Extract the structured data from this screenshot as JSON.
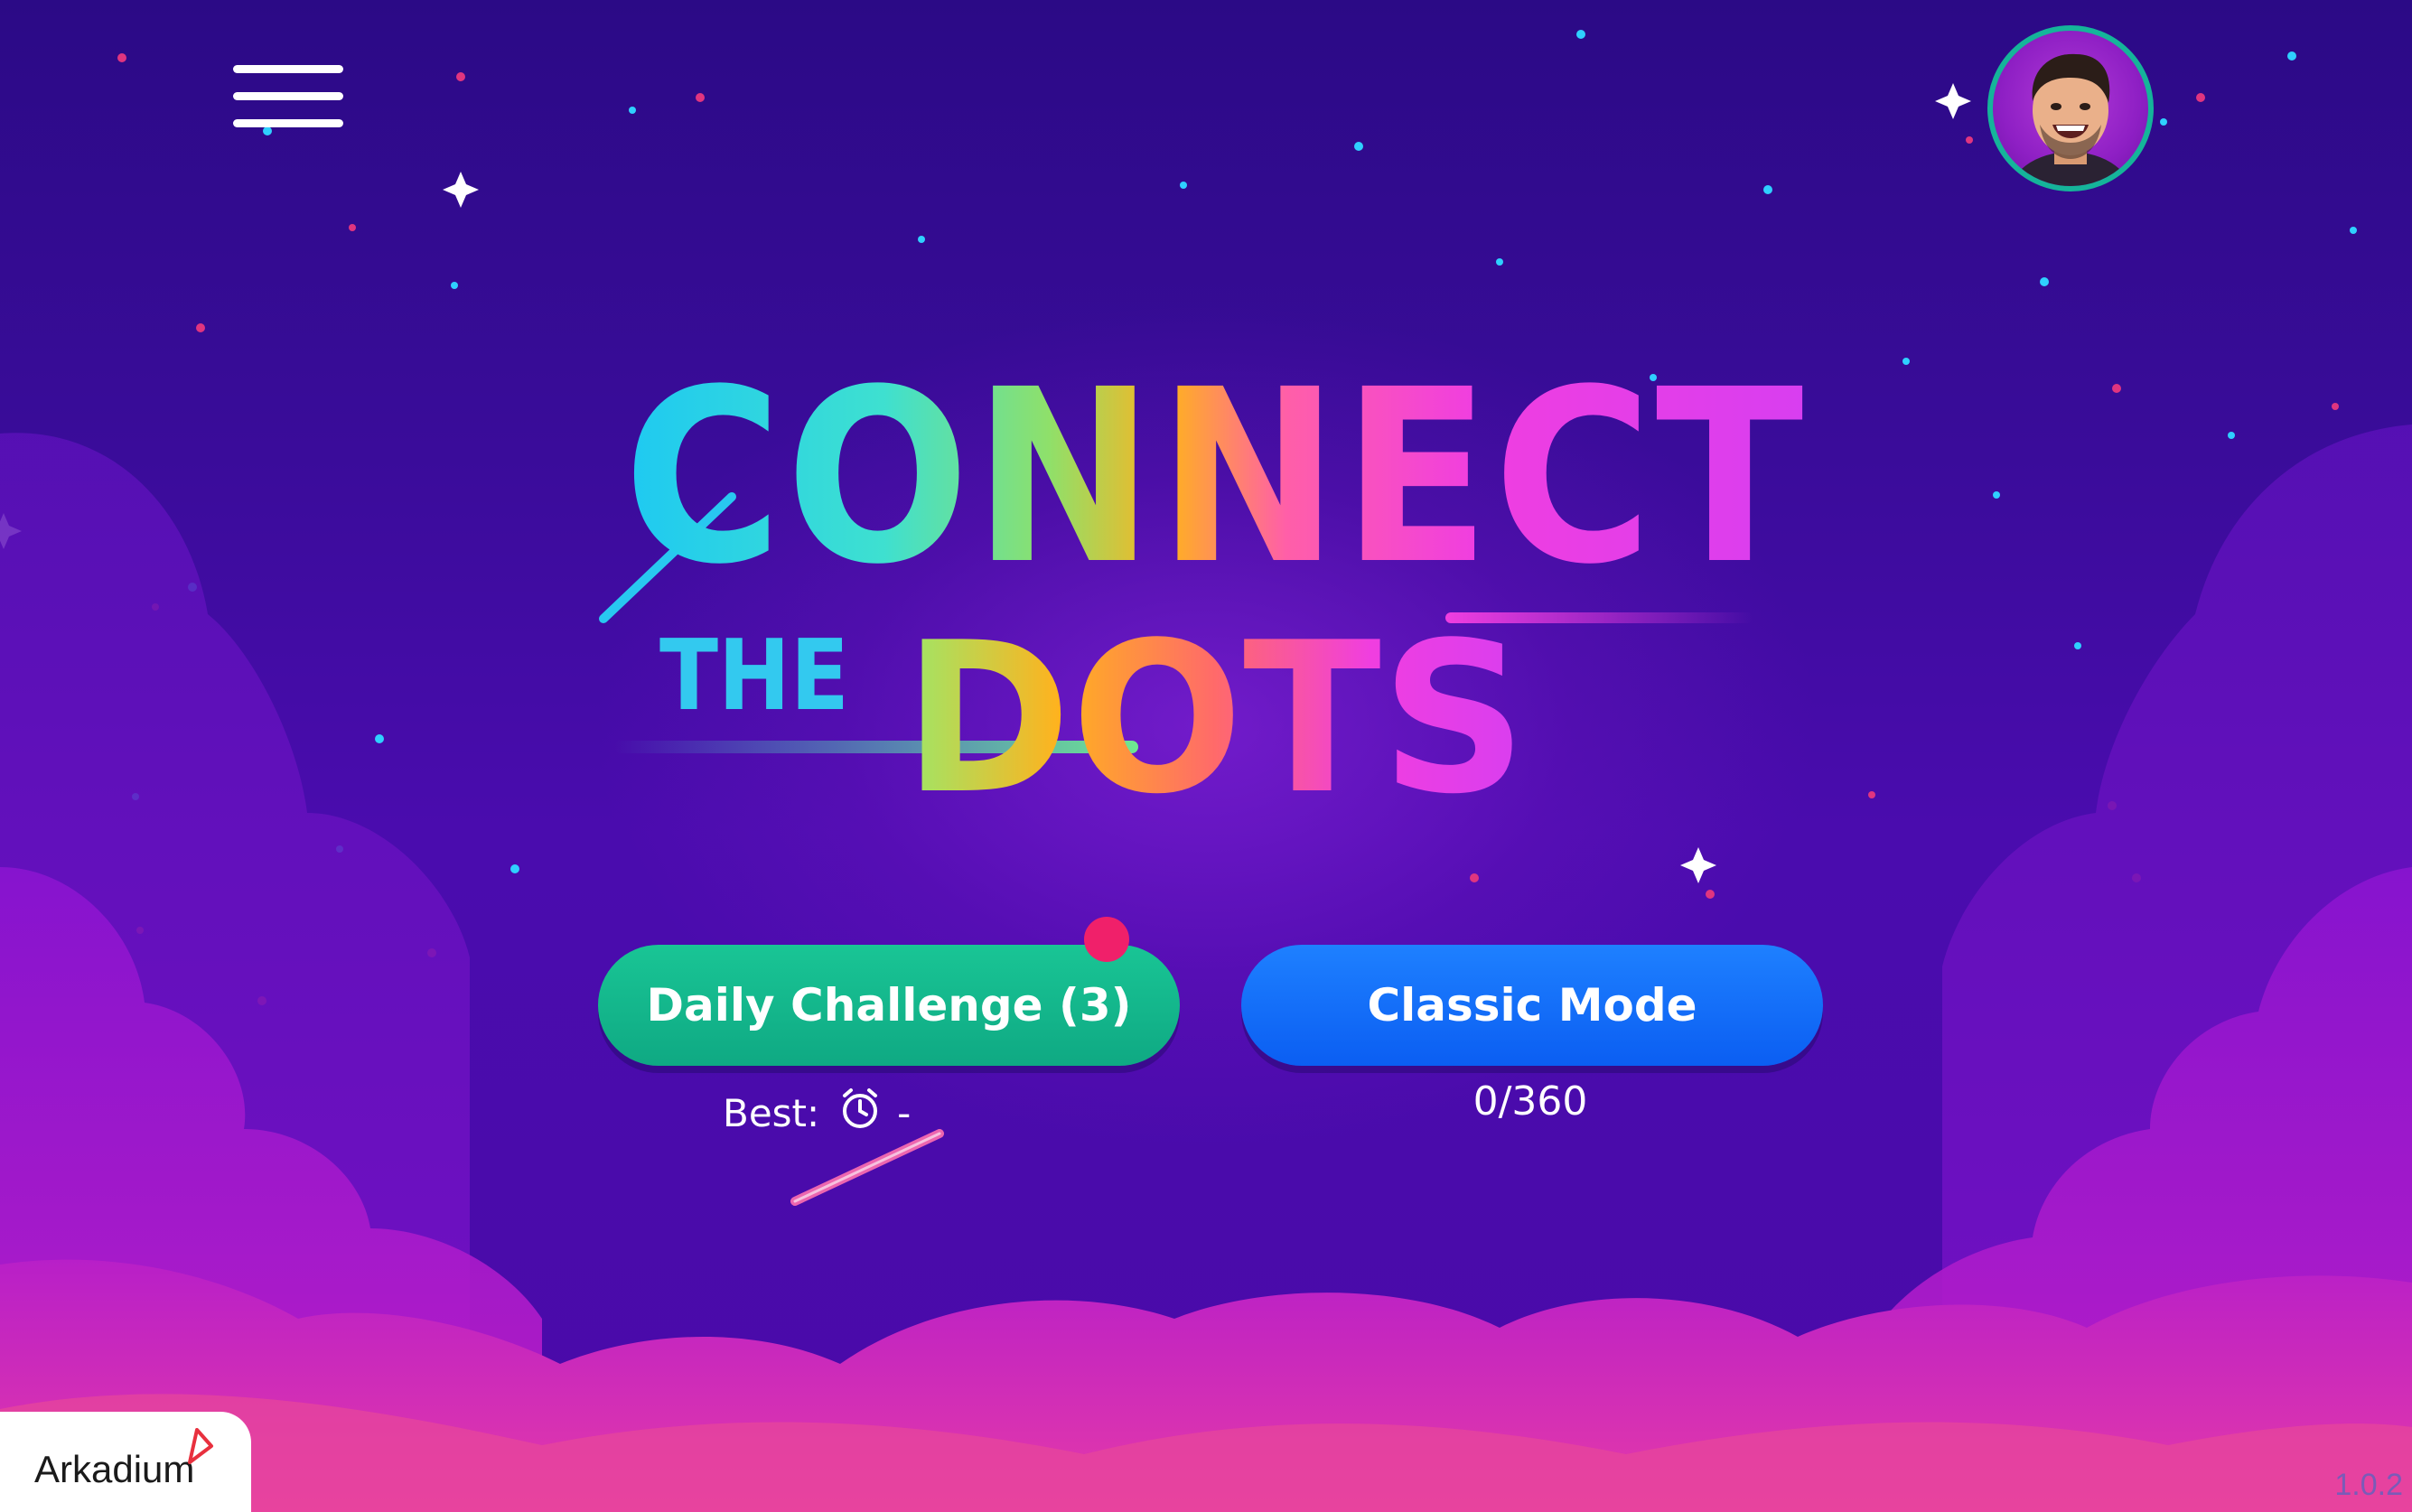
{
  "app": {
    "publisher": "Arkadium",
    "version": "1.0.2"
  },
  "header": {
    "menu_icon": "hamburger-menu-icon",
    "avatar_icon": "user-avatar"
  },
  "logo": {
    "line1": "CONNECT",
    "line2a": "THE",
    "line2b": "DOTS"
  },
  "daily": {
    "label": "Daily Challenge (3)",
    "best_label": "Best:",
    "best_value": "-",
    "timer_icon": "stopwatch-icon",
    "badge_color": "#f0206a"
  },
  "classic": {
    "label": "Classic Mode",
    "progress": "0/360"
  },
  "colors": {
    "daily_button": "#13b98e",
    "classic_button": "#0f66f5",
    "background": "#3a0c9a",
    "avatar_ring": "#15b49a"
  }
}
